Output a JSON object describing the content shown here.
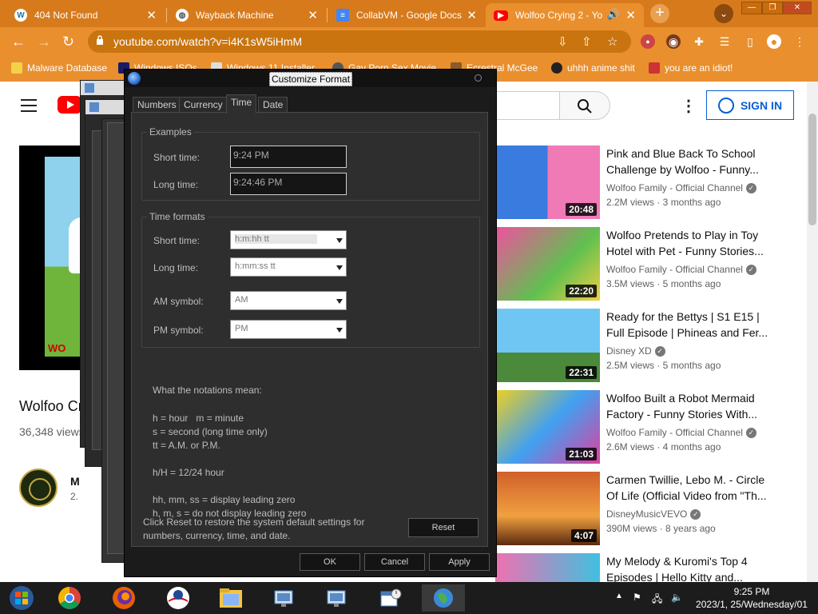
{
  "browser": {
    "tabs": [
      {
        "title": "404 Not Found",
        "icon": "wordpress-icon"
      },
      {
        "title": "Wayback Machine",
        "icon": "globe-icon"
      },
      {
        "title": "CollabVM - Google Docs",
        "icon": "docs-icon"
      },
      {
        "title": "Wolfoo Crying 2 - Yo",
        "icon": "youtube-icon"
      }
    ],
    "url": "youtube.com/watch?v=i4K1sW5iHmM",
    "bookmarks": [
      {
        "label": "Malware Database"
      },
      {
        "label": "Windows ISOs"
      },
      {
        "label": "Windows 11 Installer"
      },
      {
        "label": "Gay Porn Sex Movie"
      },
      {
        "label": "Ecrestral McGee"
      },
      {
        "label": "uhhh anime shit"
      },
      {
        "label": "you are an idiot!"
      }
    ]
  },
  "youtube": {
    "signin": "SIGN IN",
    "video_title": "Wolfoo Cr",
    "video_views": "36,348 views",
    "channel_initial": "M",
    "channel_sub": "2.",
    "player_logo": "WO",
    "recommendations": [
      {
        "title": "Pink and Blue Back To School Challenge by Wolfoo - Funny...",
        "channel": "Wolfoo Family - Official Channel",
        "meta": "2.2M views · 3 months ago",
        "duration": "20:48",
        "verified": true
      },
      {
        "title": "Wolfoo Pretends to Play in Toy Hotel with Pet - Funny Stories...",
        "channel": "Wolfoo Family - Official Channel",
        "meta": "3.5M views · 5 months ago",
        "duration": "22:20",
        "verified": true
      },
      {
        "title": "Ready for the Bettys | S1 E15 | Full Episode | Phineas and Fer...",
        "channel": "Disney XD",
        "meta": "2.5M views · 5 months ago",
        "duration": "22:31",
        "verified": true
      },
      {
        "title": "Wolfoo Built a Robot Mermaid Factory - Funny Stories With...",
        "channel": "Wolfoo Family - Official Channel",
        "meta": "2.6M views · 4 months ago",
        "duration": "21:03",
        "verified": true
      },
      {
        "title": "Carmen Twillie, Lebo M. - Circle Of Life (Official Video from \"Th...",
        "channel": "DisneyMusicVEVO",
        "meta": "390M views · 8 years ago",
        "duration": "4:07",
        "verified": true
      },
      {
        "title": "My Melody & Kuromi's Top 4 Episodes | Hello Kitty and...",
        "channel": "",
        "meta": "",
        "duration": "",
        "verified": false
      }
    ]
  },
  "dialog": {
    "title": "Customize Format",
    "tabs": [
      "Numbers",
      "Currency",
      "Time",
      "Date"
    ],
    "active_tab": "Time",
    "examples": {
      "legend": "Examples",
      "short_label": "Short time:",
      "short_value": "9:24 PM",
      "long_label": "Long time:",
      "long_value": "9:24:46 PM"
    },
    "formats": {
      "legend": "Time formats",
      "short_label": "Short time:",
      "short_value": "h:m:hh tt",
      "long_label": "Long time:",
      "long_value": "h:mm:ss tt",
      "am_label": "AM symbol:",
      "am_value": "AM",
      "pm_label": "PM symbol:",
      "pm_value": "PM"
    },
    "notations": {
      "heading": "What the notations mean:",
      "l1": "h = hour   m = minute",
      "l2": "s = second (long time only)",
      "l3": "tt = A.M. or P.M.",
      "l4": "h/H = 12/24 hour",
      "l5": "hh, mm, ss = display leading zero",
      "l6": "h, m, s = do not display leading zero"
    },
    "reset_text": "Click Reset to restore the system default settings for numbers, currency, time, and date.",
    "reset_label": "Reset",
    "ok_label": "OK",
    "cancel_label": "Cancel",
    "apply_label": "Apply"
  },
  "taskbar": {
    "time": "9:25 PM",
    "date": "2023/1, 25/Wednesday/01"
  },
  "colors": {
    "chrome_theme": "#e98f2e",
    "youtube_red": "#ff0000",
    "signin_blue": "#065fd4",
    "dialog_bg": "#2e2e2e"
  }
}
